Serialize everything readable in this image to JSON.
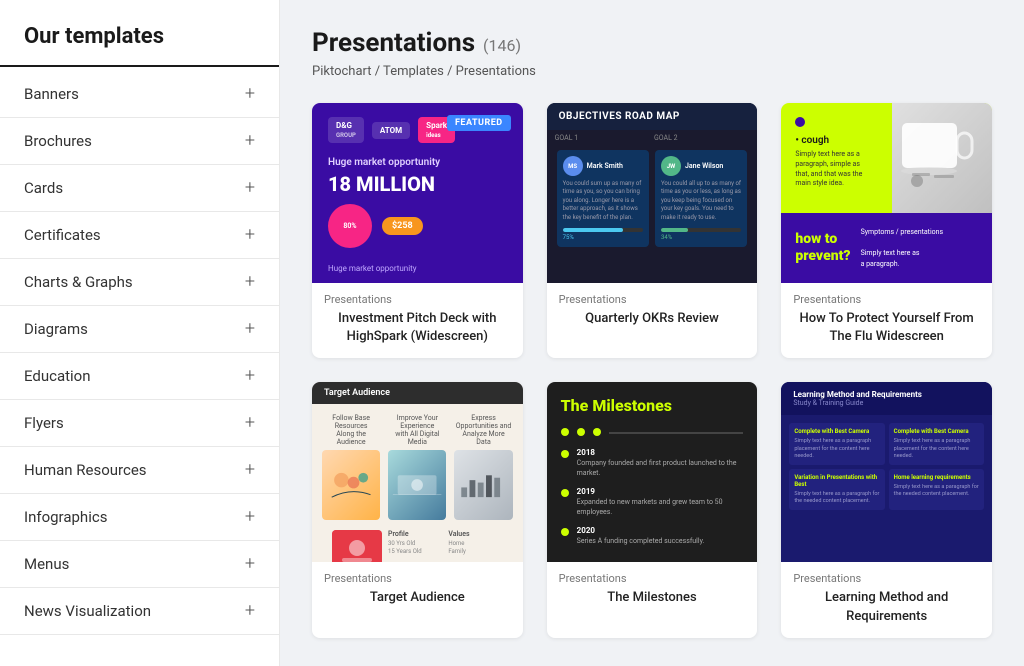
{
  "sidebar": {
    "title": "Our templates",
    "items": [
      {
        "label": "Banners",
        "id": "banners"
      },
      {
        "label": "Brochures",
        "id": "brochures"
      },
      {
        "label": "Cards",
        "id": "cards"
      },
      {
        "label": "Certificates",
        "id": "certificates"
      },
      {
        "label": "Charts & Graphs",
        "id": "charts-graphs"
      },
      {
        "label": "Diagrams",
        "id": "diagrams"
      },
      {
        "label": "Education",
        "id": "education"
      },
      {
        "label": "Flyers",
        "id": "flyers"
      },
      {
        "label": "Human Resources",
        "id": "human-resources"
      },
      {
        "label": "Infographics",
        "id": "infographics"
      },
      {
        "label": "Menus",
        "id": "menus"
      },
      {
        "label": "News Visualization",
        "id": "news-visualization"
      }
    ],
    "plus_icon": "+"
  },
  "main": {
    "title": "Presentations",
    "count": "(146)",
    "breadcrumb": "Piktochart / Templates / Presentations",
    "templates": [
      {
        "id": "template-1",
        "category": "Presentations",
        "name": "Investment Pitch Deck with HighSpark (Widescreen)",
        "featured": "FEATURED"
      },
      {
        "id": "template-2",
        "category": "Presentations",
        "name": "Quarterly OKRs Review"
      },
      {
        "id": "template-3",
        "category": "Presentations",
        "name": "How To Protect Yourself From The Flu Widescreen"
      },
      {
        "id": "template-4",
        "category": "Presentations",
        "name": "Target Audience"
      },
      {
        "id": "template-5",
        "category": "Presentations",
        "name": "The Milestones"
      },
      {
        "id": "template-6",
        "category": "Presentations",
        "name": "Learning Method and Requirements"
      }
    ]
  }
}
